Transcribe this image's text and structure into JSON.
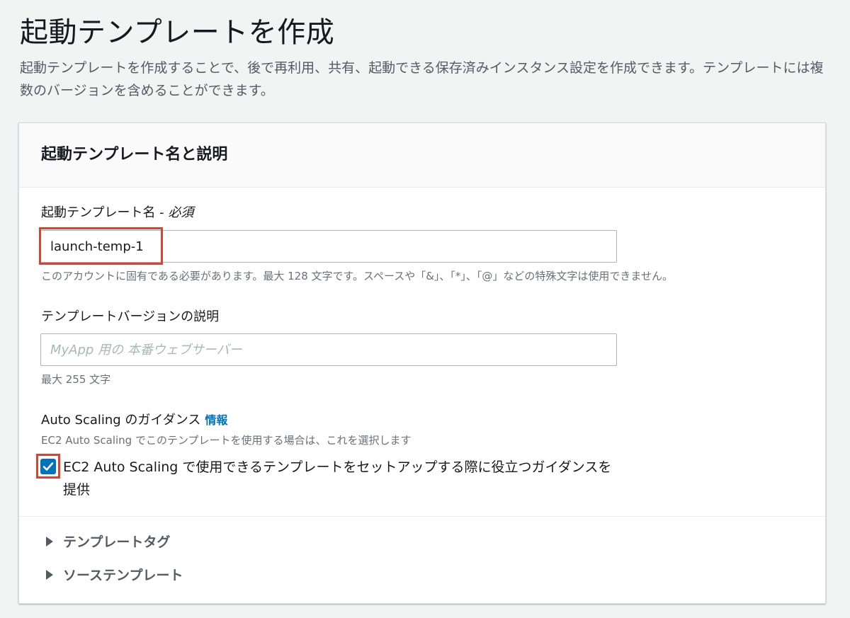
{
  "page": {
    "title": "起動テンプレートを作成",
    "description": "起動テンプレートを作成することで、後で再利用、共有、起動できる保存済みインスタンス設定を作成できます。テンプレートには複数のバージョンを含めることができます。"
  },
  "panel": {
    "title": "起動テンプレート名と説明",
    "name_field": {
      "label": "起動テンプレート名 - ",
      "required": "必須",
      "value": "launch-temp-1",
      "hint": "このアカウントに固有である必要があります。最大 128 文字です。スペースや「&」、「*」、「@」などの特殊文字は使用できません。"
    },
    "description_field": {
      "label": "テンプレートバージョンの説明",
      "placeholder": "MyApp 用の 本番ウェブサーバー",
      "value": "",
      "hint": "最大 255 文字"
    },
    "autoscaling": {
      "label": "Auto Scaling のガイダンス",
      "info_link": "情報",
      "hint": "EC2 Auto Scaling でこのテンプレートを使用する場合は、これを選択します",
      "checkbox_label": "EC2 Auto Scaling で使用できるテンプレートをセットアップする際に役立つガイダンスを提供",
      "checked": true
    },
    "expanders": [
      {
        "label": "テンプレートタグ"
      },
      {
        "label": "ソーステンプレート"
      }
    ]
  },
  "colors": {
    "highlight": "#e0412f",
    "accent": "#0073bb",
    "background": "#f2f3f3"
  }
}
